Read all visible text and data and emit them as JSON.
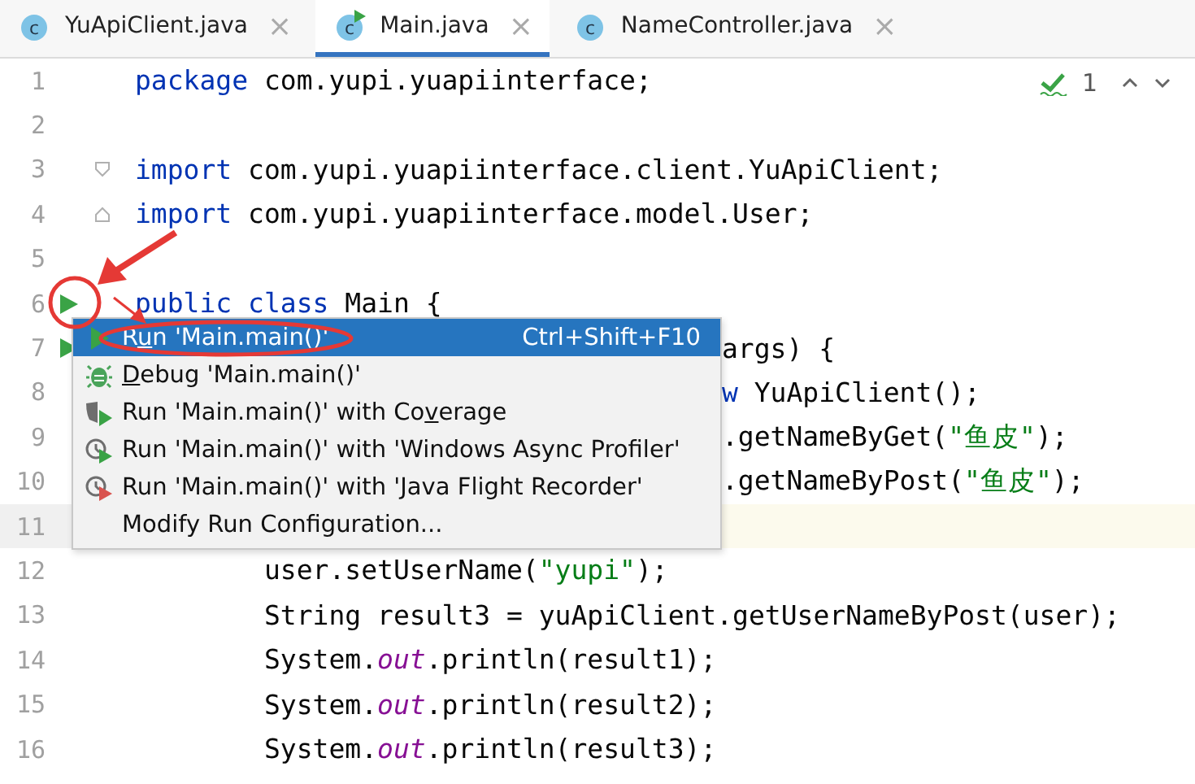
{
  "tabs": [
    {
      "badge": "c",
      "label": "YuApiClient.java",
      "runnable": false,
      "selected": false,
      "close": "×"
    },
    {
      "badge": "c",
      "label": "Main.java",
      "runnable": true,
      "selected": true,
      "close": "×"
    },
    {
      "badge": "c",
      "label": "NameController.java",
      "runnable": false,
      "selected": false,
      "close": "×"
    }
  ],
  "inspection": {
    "count": "1"
  },
  "lines": [
    {
      "number": "1",
      "covered": false,
      "current": false,
      "segments": [
        {
          "kind": "keyword",
          "text": "package"
        },
        {
          "kind": "plain",
          "text": " com.yupi.yuapiinterface;"
        }
      ]
    },
    {
      "number": "2",
      "current": false
    },
    {
      "number": "3",
      "covered": false,
      "current": false,
      "marker": {
        "kind": "fold_start"
      },
      "segments": [
        {
          "kind": "keyword",
          "text": "import"
        },
        {
          "kind": "plain",
          "text": " com.yupi.yuapiinterface.client.YuApiClient;"
        }
      ]
    },
    {
      "number": "4",
      "covered": false,
      "current": false,
      "marker": {
        "kind": "fold_end"
      },
      "segments": [
        {
          "kind": "keyword",
          "text": "import"
        },
        {
          "kind": "plain",
          "text": " com.yupi.yuapiinterface.model.User;"
        }
      ]
    },
    {
      "number": "5",
      "current": false
    },
    {
      "number": "6",
      "covered": false,
      "current": false,
      "marker": {
        "kind": "run"
      },
      "segments": [
        {
          "kind": "keyword",
          "text": "public class"
        },
        {
          "kind": "plain",
          "text": " Main {"
        }
      ]
    },
    {
      "number": "7",
      "covered": true,
      "current": false,
      "marker": {
        "kind": "run"
      },
      "segments": [
        {
          "kind": "plain",
          "text": "args) {"
        }
      ]
    },
    {
      "number": "8",
      "covered": true,
      "current": false,
      "segments": [
        {
          "kind": "keyword",
          "text": "w"
        },
        {
          "kind": "plain",
          "text": " YuApiClient();"
        }
      ]
    },
    {
      "number": "9",
      "covered": true,
      "current": false,
      "segments": [
        {
          "kind": "plain",
          "text": ".getNameByGet("
        },
        {
          "kind": "string",
          "text": "\"鱼皮\""
        },
        {
          "kind": "plain",
          "text": ");"
        }
      ]
    },
    {
      "number": "10",
      "covered": true,
      "current": false,
      "segments": [
        {
          "kind": "plain",
          "text": ".getNameByPost("
        },
        {
          "kind": "string",
          "text": "\"鱼皮\""
        },
        {
          "kind": "plain",
          "text": ");"
        }
      ]
    },
    {
      "number": "11",
      "current": true
    },
    {
      "number": "12",
      "covered": false,
      "current": false,
      "segments": [
        {
          "kind": "plain",
          "text": "        user.setUserName("
        },
        {
          "kind": "string",
          "text": "\"yupi\""
        },
        {
          "kind": "plain",
          "text": ");"
        }
      ]
    },
    {
      "number": "13",
      "covered": false,
      "current": false,
      "segments": [
        {
          "kind": "plain",
          "text": "        String result3 = yuApiClient.getUserNameByPost(user);"
        }
      ]
    },
    {
      "number": "14",
      "covered": false,
      "current": false,
      "segments": [
        {
          "kind": "plain",
          "text": "        System."
        },
        {
          "kind": "field",
          "text": "out"
        },
        {
          "kind": "plain",
          "text": ".println(result1);"
        }
      ]
    },
    {
      "number": "15",
      "covered": false,
      "current": false,
      "segments": [
        {
          "kind": "plain",
          "text": "        System."
        },
        {
          "kind": "field",
          "text": "out"
        },
        {
          "kind": "plain",
          "text": ".println(result2);"
        }
      ]
    },
    {
      "number": "16",
      "covered": false,
      "current": false,
      "segments": [
        {
          "kind": "plain",
          "text": "        System."
        },
        {
          "kind": "field",
          "text": "out"
        },
        {
          "kind": "plain",
          "text": ".println(result3);"
        }
      ]
    }
  ],
  "menu": {
    "items": [
      {
        "kind": "run",
        "label_parts": [
          {
            "text": "R",
            "underline": false
          },
          {
            "text": "u",
            "underline": true
          },
          {
            "text": "n 'Main.main()'",
            "underline": false
          }
        ],
        "shortcut": "Ctrl+Shift+F10",
        "selected": true
      },
      {
        "kind": "debug",
        "label_parts": [
          {
            "text": "D",
            "underline": true
          },
          {
            "text": "ebug 'Main.main()'",
            "underline": false
          }
        ],
        "selected": false
      },
      {
        "kind": "coverage",
        "label_parts": [
          {
            "text": "Run 'Main.main()' with Co",
            "underline": false
          },
          {
            "text": "v",
            "underline": true
          },
          {
            "text": "erage",
            "underline": false
          }
        ],
        "selected": false
      },
      {
        "kind": "profiler",
        "label_parts": [
          {
            "text": "Run 'Main.main()' with 'Windows Async Profiler'",
            "underline": false
          }
        ],
        "selected": false
      },
      {
        "kind": "recorder",
        "label_parts": [
          {
            "text": "Run 'Main.main()' with 'Java Flight Recorder'",
            "underline": false
          }
        ],
        "selected": false
      },
      {
        "kind": "plain",
        "label_parts": [
          {
            "text": "Modify Run Configuration...",
            "underline": false
          }
        ],
        "selected": false
      }
    ]
  }
}
